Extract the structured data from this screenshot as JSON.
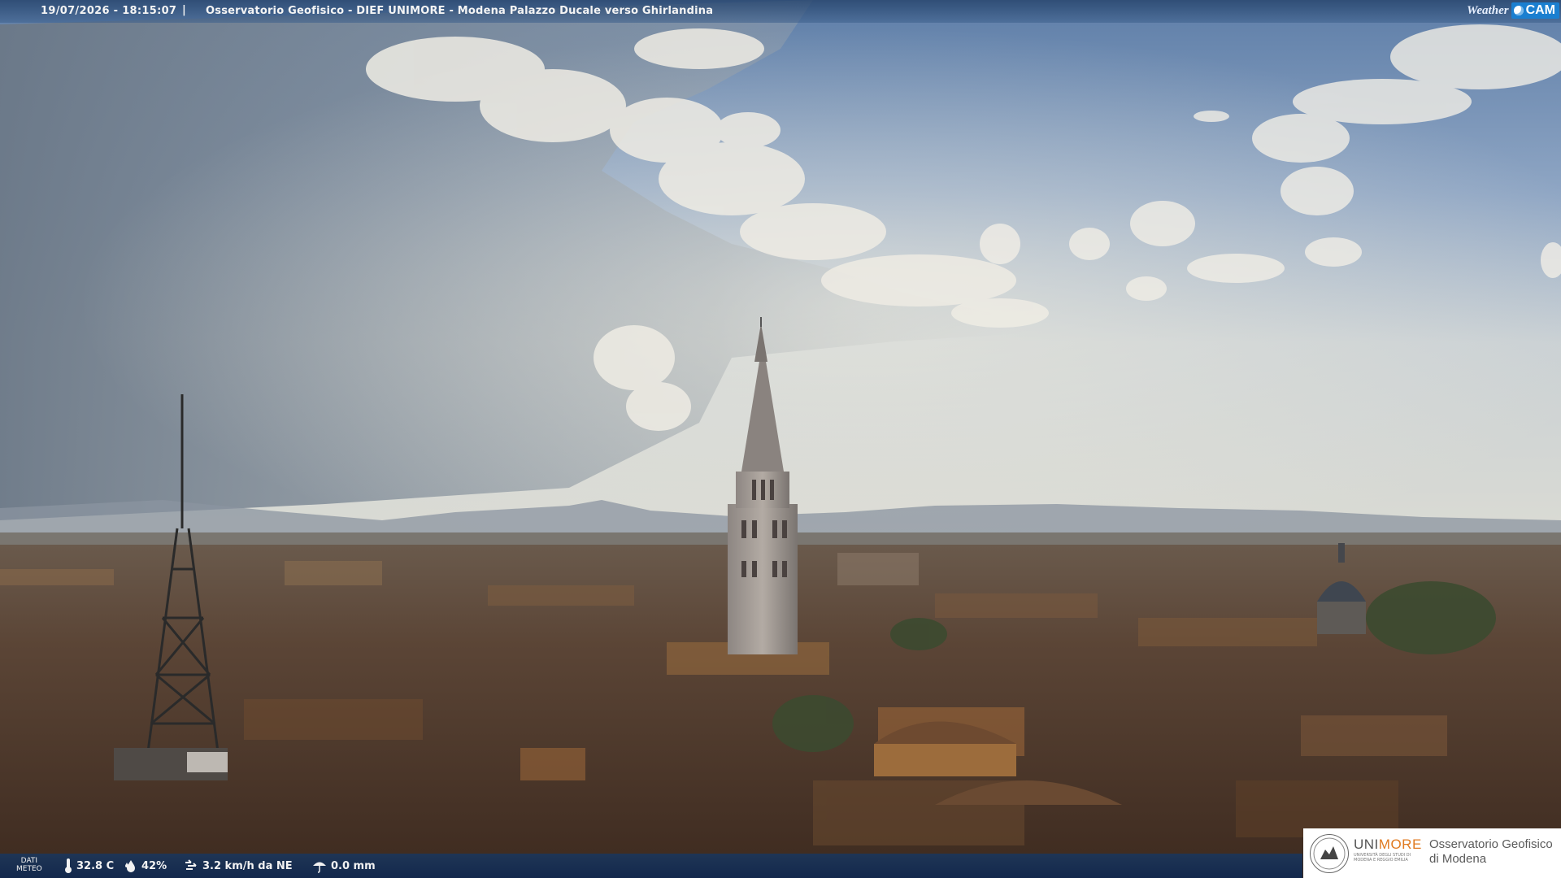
{
  "overlay": {
    "timestamp": "19/07/2026 - 18:15:07",
    "separator": "|",
    "caption": "Osservatorio Geofisico - DIEF UNIMORE - Modena Palazzo Ducale verso Ghirlandina",
    "brand": {
      "weather": "Weather",
      "cam": "CAM"
    }
  },
  "meteo": {
    "label_line1": "DATI",
    "label_line2": "METEO",
    "items": [
      {
        "icon": "thermometer-icon",
        "value": "32.8 C"
      },
      {
        "icon": "humidity-drop-icon",
        "value": "42%"
      },
      {
        "icon": "wind-icon",
        "value": "3.2 km/h da NE"
      },
      {
        "icon": "rain-icon",
        "value": "0.0 mm"
      }
    ]
  },
  "logo": {
    "uni_a": "UNI",
    "uni_b": "MORE",
    "uni_sub": "UNIVERSITÀ DEGLI STUDI DI MODENA E REGGIO EMILIA",
    "obs_line1": "Osservatorio Geofisico",
    "obs_line2": "di Modena"
  },
  "colors": {
    "sky_top": "#6f8fb8",
    "sky_horizon": "#d8dcd6",
    "cloud": "#ece9e0",
    "roofs": "#5a3f30",
    "accent_orange": "#e07a20"
  }
}
